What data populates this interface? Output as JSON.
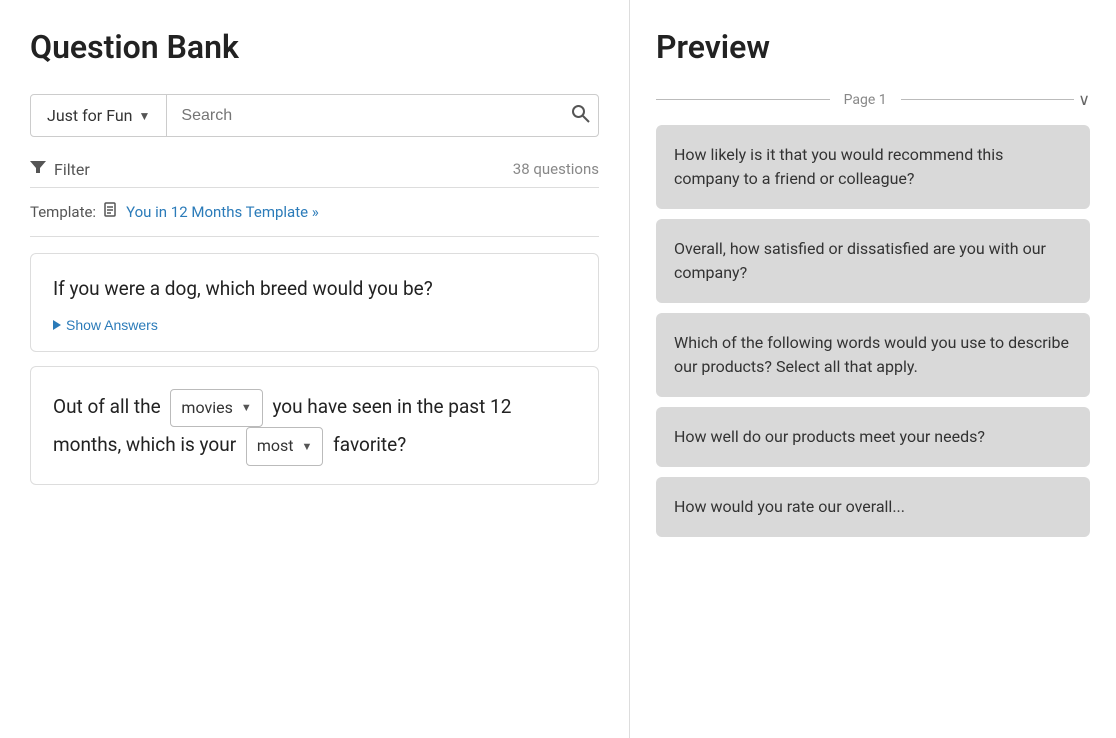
{
  "left": {
    "title": "Question Bank",
    "category": {
      "label": "Just for Fun",
      "dropdown_arrow": "▼"
    },
    "search": {
      "placeholder": "Search"
    },
    "filter": {
      "label": "Filter",
      "count": "38 questions"
    },
    "template": {
      "label": "Template:",
      "link_text": "You in 12 Months Template »"
    },
    "questions": [
      {
        "id": "q1",
        "type": "simple",
        "text": "If you were a dog, which breed would you be?",
        "show_answers": "Show Answers"
      },
      {
        "id": "q2",
        "type": "fill",
        "prefix": "Out of all the",
        "dropdown1": "movies",
        "middle": "you have seen in the past 12 months, which is your",
        "dropdown2": "most",
        "suffix": "favorite?"
      }
    ]
  },
  "right": {
    "title": "Preview",
    "page": {
      "label": "Page 1",
      "chevron": "∨"
    },
    "preview_questions": [
      {
        "id": "pq1",
        "text": "How likely is it that you would recommend this company to a friend or colleague?"
      },
      {
        "id": "pq2",
        "text": "Overall, how satisfied or dissatisfied are you with our company?"
      },
      {
        "id": "pq3",
        "text": "Which of the following words would you use to describe our products? Select all that apply."
      },
      {
        "id": "pq4",
        "text": "How well do our products meet your needs?"
      },
      {
        "id": "pq5",
        "text": "How would you rate our overall..."
      }
    ]
  }
}
